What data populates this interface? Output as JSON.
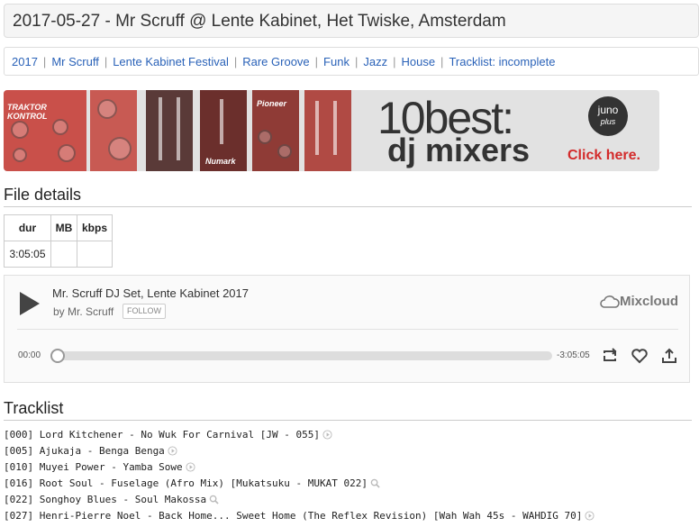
{
  "page": {
    "title": "2017-05-27 - Mr Scruff @ Lente Kabinet, Het Twiske, Amsterdam"
  },
  "tags": [
    "2017",
    "Mr Scruff",
    "Lente Kabinet Festival",
    "Rare Groove",
    "Funk",
    "Jazz",
    "House",
    "Tracklist: incomplete"
  ],
  "banner": {
    "headline": "10best:",
    "subline": "dj mixers",
    "brand": "juno",
    "brand_sub": "plus",
    "cta": "Click here.",
    "tile_labels": [
      "TRAKTOR KONTROL",
      "Numark",
      "Pioneer"
    ]
  },
  "file_details": {
    "heading": "File details",
    "columns": [
      "dur",
      "MB",
      "kbps"
    ],
    "row": [
      "3:05:05",
      "",
      ""
    ]
  },
  "player": {
    "title": "Mr. Scruff DJ Set, Lente Kabinet 2017",
    "by_prefix": "by",
    "artist": "Mr. Scruff",
    "follow_label": "FOLLOW",
    "brand": "Mixcloud",
    "elapsed": "00:00",
    "remaining": "-3:05:05",
    "progress": 0
  },
  "tracklist": {
    "heading": "Tracklist",
    "items": [
      {
        "text": "[000] Lord Kitchener - No Wuk For Carnival [JW - 055]",
        "icon": "play-icon"
      },
      {
        "text": "[005] Ajukaja - Benga Benga",
        "icon": "play-icon"
      },
      {
        "text": "[010] Muyei Power - Yamba Sowe",
        "icon": "play-icon"
      },
      {
        "text": "[016] Root Soul - Fuselage (Afro Mix) [Mukatsuku - MUKAT 022]",
        "icon": "search-icon"
      },
      {
        "text": "[022] Songhoy Blues - Soul Makossa",
        "icon": "search-icon"
      },
      {
        "text": "[027] Henri-Pierre Noel - Back Home... Sweet Home (The Reflex Revision) [Wah Wah 45s - WAHDIG 70]",
        "icon": "play-icon"
      }
    ]
  },
  "colors": {
    "link": "#2a62b8",
    "banner_red": "#d32b2b",
    "tile_red": "#c9504a"
  }
}
